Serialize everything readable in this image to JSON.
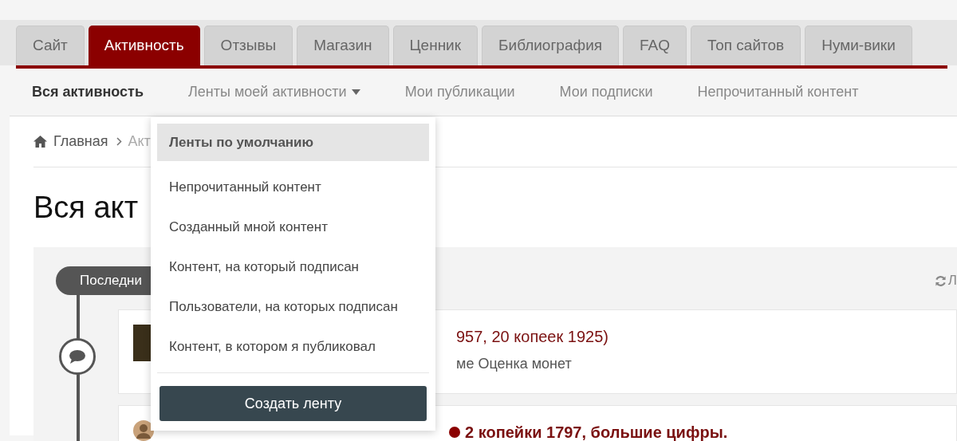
{
  "tabs": [
    {
      "label": "Сайт",
      "selected": false
    },
    {
      "label": "Активность",
      "selected": true
    },
    {
      "label": "Отзывы",
      "selected": false
    },
    {
      "label": "Магазин",
      "selected": false
    },
    {
      "label": "Ценник",
      "selected": false
    },
    {
      "label": "Библиография",
      "selected": false
    },
    {
      "label": "FAQ",
      "selected": false
    },
    {
      "label": "Топ сайтов",
      "selected": false
    },
    {
      "label": "Нуми-вики",
      "selected": false
    }
  ],
  "subnav": [
    {
      "label": "Вся активность",
      "selected": true,
      "dropdown": false
    },
    {
      "label": "Ленты моей активности",
      "selected": false,
      "dropdown": true
    },
    {
      "label": "Мои публикации",
      "selected": false,
      "dropdown": false
    },
    {
      "label": "Мои подписки",
      "selected": false,
      "dropdown": false
    },
    {
      "label": "Непрочитанный контент",
      "selected": false,
      "dropdown": false
    }
  ],
  "breadcrumb": [
    "Главная",
    "Акт"
  ],
  "page_title": "Вся акт",
  "stream": {
    "pill": "Последни",
    "refresh_label": "Л",
    "items": [
      {
        "kind": "photo",
        "title": "957, 20 копеек 1925)",
        "subtitle": "ме Оценка монет",
        "unread": false
      },
      {
        "kind": "avatar",
        "title": "2 копейки 1797, большие цифры.",
        "unread": true
      }
    ]
  },
  "dropdown_menu": {
    "header": "Ленты по умолчанию",
    "items": [
      "Непрочитанный контент",
      "Созданный мной контент",
      "Контент, на который подписан",
      "Пользователи, на которых подписан",
      "Контент, в котором я публиковал"
    ],
    "button": "Создать ленту"
  }
}
